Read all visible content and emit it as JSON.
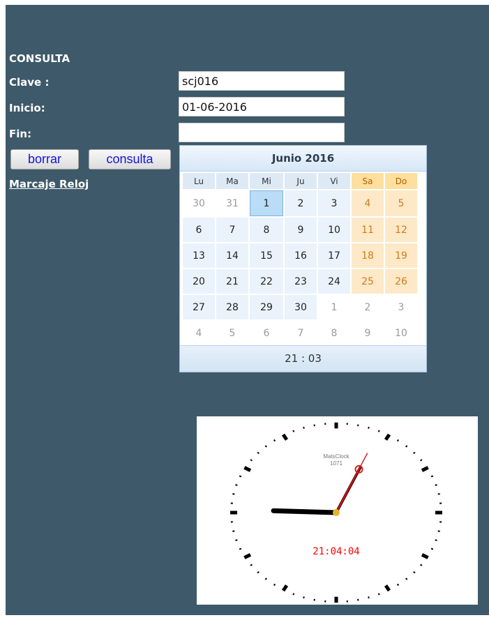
{
  "form": {
    "heading": "CONSULTA",
    "clave_label": "Clave :",
    "clave_value": "scj016",
    "inicio_label": "Inicio:",
    "inicio_value": "01-06-2016",
    "fin_label": "Fin:",
    "fin_value": "",
    "borrar_label": "borrar",
    "consulta_label": "consulta",
    "link_label": "Marcaje Reloj"
  },
  "calendar": {
    "title": "Junio 2016",
    "weekdays": [
      "Lu",
      "Ma",
      "Mi",
      "Ju",
      "Vi",
      "Sa",
      "Do"
    ],
    "weeks": [
      [
        "30",
        "31",
        "1",
        "2",
        "3",
        "4",
        "5"
      ],
      [
        "6",
        "7",
        "8",
        "9",
        "10",
        "11",
        "12"
      ],
      [
        "13",
        "14",
        "15",
        "16",
        "17",
        "18",
        "19"
      ],
      [
        "20",
        "21",
        "22",
        "23",
        "24",
        "25",
        "26"
      ],
      [
        "27",
        "28",
        "29",
        "30",
        "1",
        "2",
        "3"
      ],
      [
        "4",
        "5",
        "6",
        "7",
        "8",
        "9",
        "10"
      ]
    ],
    "selected_day": "1",
    "time": "21 : 03"
  },
  "clock": {
    "brand": "MatsClock",
    "model": "1071",
    "digital_time": "21:04:04",
    "hour": 21,
    "minute": 4,
    "second": 4,
    "hand_color": "#5a0a0a",
    "second_hand_color": "#d01f1f",
    "digital_color": "#ff0000"
  }
}
